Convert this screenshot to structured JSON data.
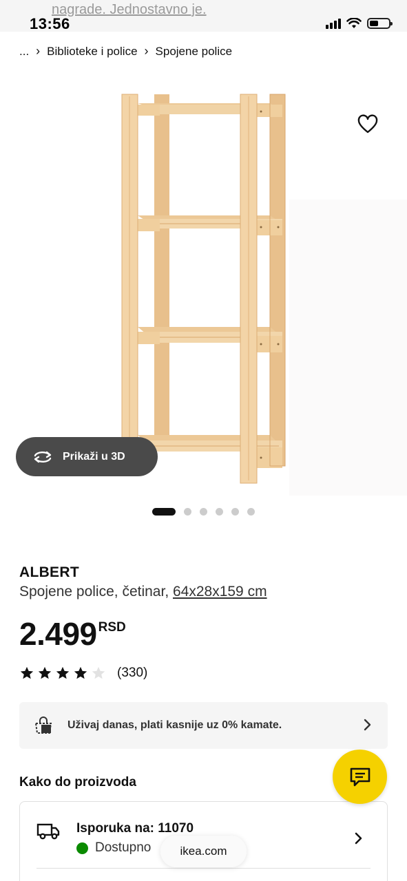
{
  "status_bar": {
    "overlay_text": "nagrade. Jednostavno je.",
    "time": "13:56"
  },
  "breadcrumb": {
    "ellipsis": "...",
    "items": [
      "Biblioteke i police",
      "Spojene police"
    ]
  },
  "gallery": {
    "view_3d_label": "Prikaži u 3D",
    "dot_count": 6,
    "active_index": 0
  },
  "product": {
    "name": "ALBERT",
    "description": "Spojene police, četinar, ",
    "dimensions": "64x28x159 cm",
    "price": "2.499",
    "currency": "RSD",
    "rating": 4,
    "rating_max": 5,
    "review_count": "(330)"
  },
  "payment_banner": {
    "text": "Uživaj danas, plati kasnije uz 0% kamate."
  },
  "delivery_section": {
    "title": "Kako do proizvoda",
    "delivery_label": "Isporuka na: 11070",
    "availability": "Dostupno"
  },
  "browser": {
    "url": "ikea.com"
  },
  "colors": {
    "accent_yellow": "#f5d100",
    "available_green": "#0a8a00",
    "wood_light": "#f2d3a8",
    "wood_mid": "#e6bb84"
  },
  "icons": [
    "heart-icon",
    "rotate-3d-icon",
    "star-icon",
    "installment-icon",
    "chevron-right-icon",
    "chat-icon",
    "truck-icon"
  ]
}
